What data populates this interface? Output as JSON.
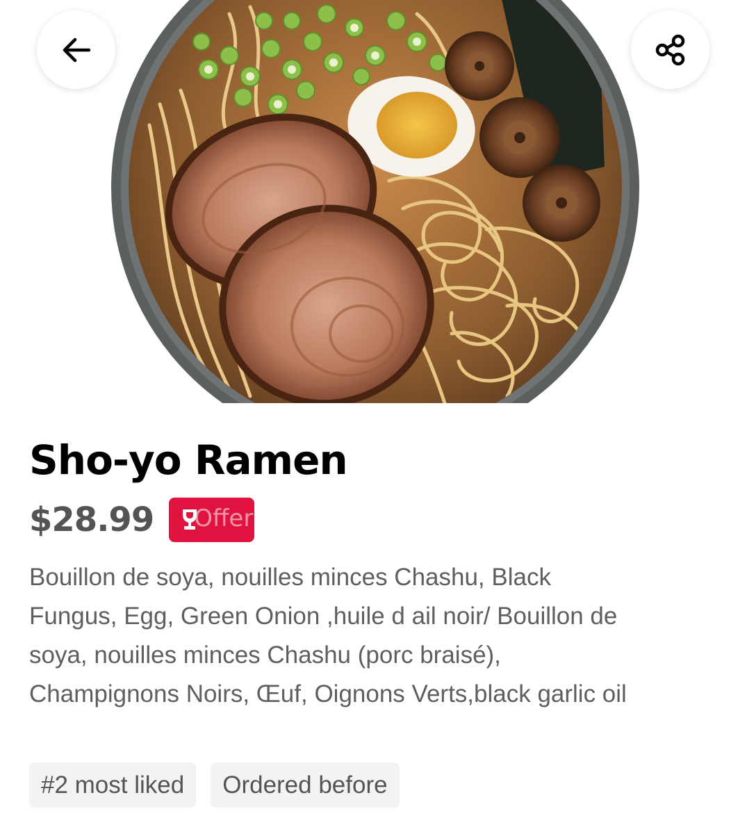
{
  "item": {
    "name": "Sho-yo Ramen",
    "price": "$28.99",
    "offer_label": "Offer",
    "description": "Bouillon de soya, nouilles minces Chashu, Black Fungus, Egg, Green Onion ,huile d ail noir/ Bouillon de soya, nouilles minces Chashu (porc braisé), Champignons Noirs, Œuf, Oignons Verts,black garlic oil",
    "tags": [
      "#2 most liked",
      "Ordered before"
    ]
  },
  "icons": {
    "back": "arrow-left-icon",
    "share": "share-icon",
    "offer": "trophy-icon"
  },
  "colors": {
    "offer_badge": "#e0123f",
    "title": "#000000",
    "price": "#545454",
    "description": "#5e5e5e",
    "tag_background": "#f3f3f3"
  }
}
